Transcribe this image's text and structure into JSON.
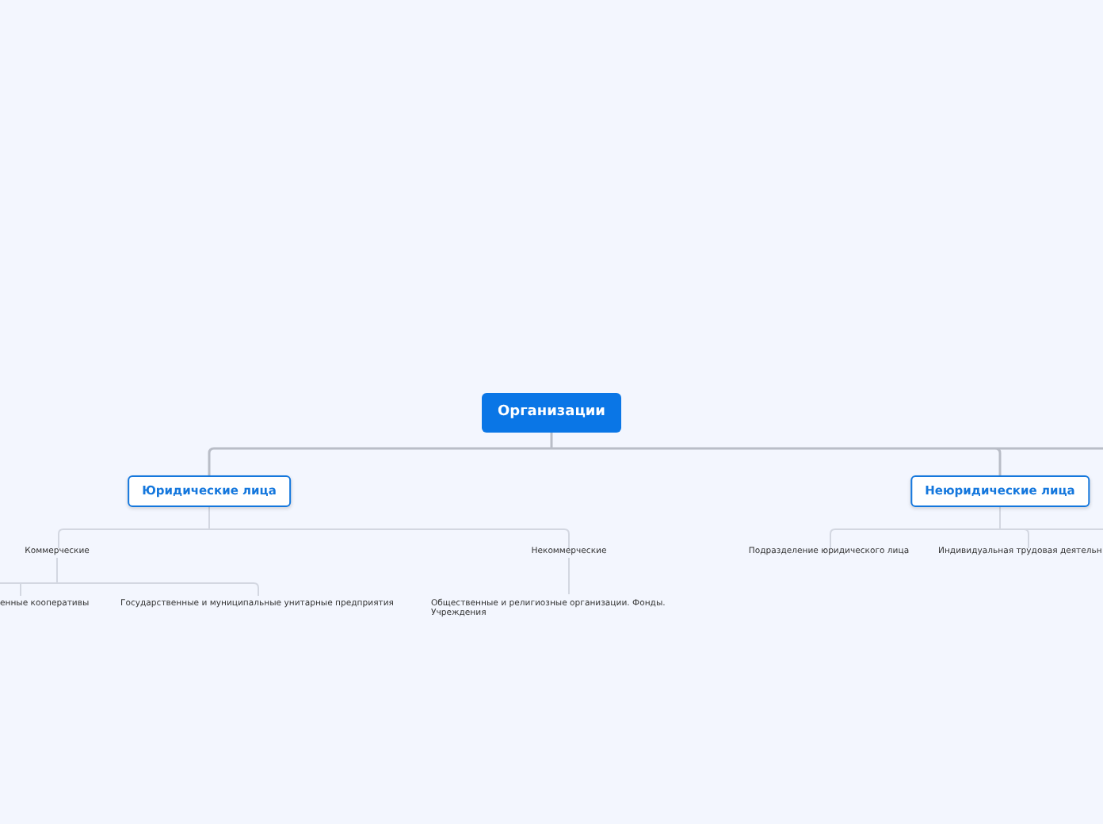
{
  "mind_map": {
    "text": "Организации",
    "kind": "root",
    "children": [
      {
        "text": "Юридические лица",
        "kind": "main",
        "children": [
          {
            "text": "Коммерческие",
            "kind": "sub",
            "children": [
              {
                "text": "енные кооперативы",
                "kind": "leaf"
              },
              {
                "text": "Государственные и муниципальные унитарные предприятия",
                "kind": "leaf"
              }
            ]
          },
          {
            "text": "Некоммерческие",
            "kind": "sub",
            "children": [
              {
                "text": "Общественные и религиозные организации. Фонды. Учреждения",
                "kind": "leaf"
              }
            ]
          }
        ]
      },
      {
        "text": "Неюридические лица",
        "kind": "main",
        "children": [
          {
            "text": "Подразделение юридического лица",
            "kind": "sub"
          },
          {
            "text": "Индивидуальная трудовая деятельн",
            "kind": "sub"
          }
        ]
      }
    ]
  }
}
